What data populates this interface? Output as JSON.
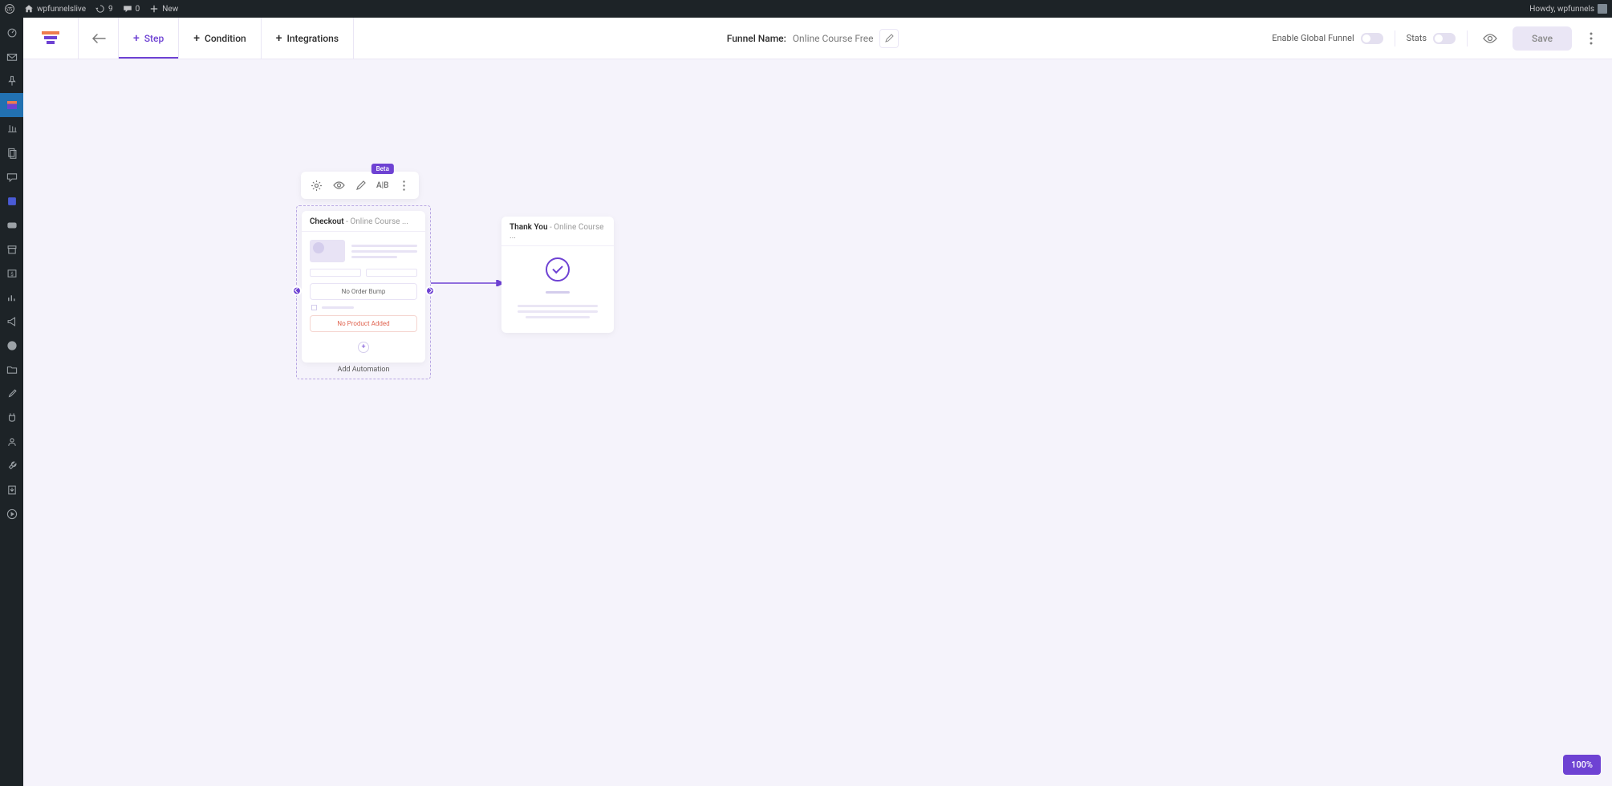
{
  "wp_bar": {
    "site_name": "wpfunnelslive",
    "updates": "9",
    "comments": "0",
    "new_label": "New",
    "greeting": "Howdy, wpfunnels"
  },
  "toolbar": {
    "tabs": {
      "step": "Step",
      "condition": "Condition",
      "integrations": "Integrations"
    },
    "funnel_name_label": "Funnel Name:",
    "funnel_name_value": "Online Course Free",
    "enable_global": "Enable Global Funnel",
    "stats": "Stats",
    "save": "Save"
  },
  "node_toolbar": {
    "ab": "A|B",
    "beta": "Beta"
  },
  "checkout": {
    "title": "Checkout",
    "subtitle": " - Online Course ...",
    "no_order_bump": "No Order Bump",
    "no_product": "No Product Added",
    "add_automation": "Add Automation"
  },
  "thankyou": {
    "title": "Thank You",
    "subtitle": " - Online Course ..."
  },
  "zoom": "100%"
}
